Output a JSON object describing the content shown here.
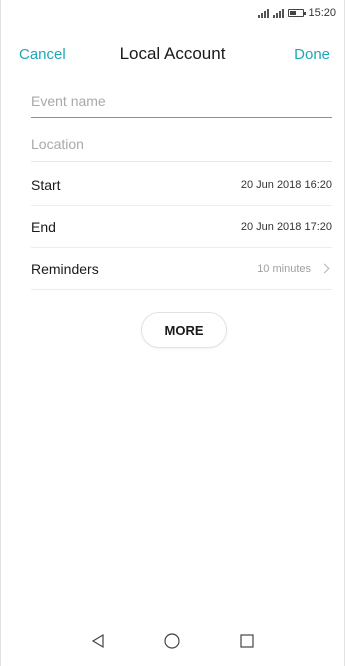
{
  "status_bar": {
    "time": "15:20"
  },
  "header": {
    "cancel_label": "Cancel",
    "title": "Local Account",
    "done_label": "Done",
    "accent_color": "#1fa7b8"
  },
  "form": {
    "event_name": {
      "value": "",
      "placeholder": "Event name"
    },
    "location": {
      "value": "",
      "placeholder": "Location"
    },
    "start": {
      "label": "Start",
      "value": "20 Jun 2018 16:20"
    },
    "end": {
      "label": "End",
      "value": "20 Jun 2018 17:20"
    },
    "reminders": {
      "label": "Reminders",
      "value": "10 minutes",
      "icon": "chevron-right-icon"
    }
  },
  "more_label": "MORE",
  "nav": {
    "back_icon": "back-triangle-icon",
    "home_icon": "home-circle-icon",
    "recents_icon": "recents-square-icon"
  }
}
